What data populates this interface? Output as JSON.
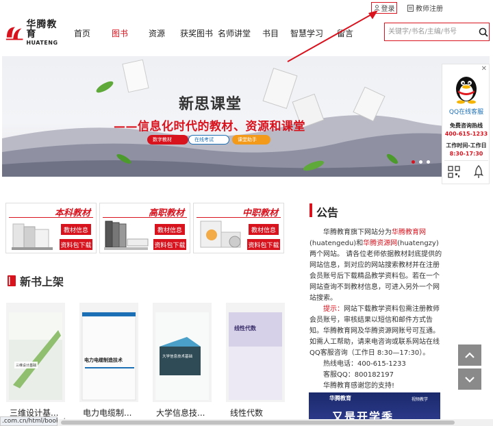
{
  "top_links": {
    "login": "登录",
    "teacher_register": "教师注册"
  },
  "logo": {
    "cn": "华腾教育",
    "en": "HUATENG"
  },
  "nav": [
    {
      "label": "首页"
    },
    {
      "label": "图书"
    },
    {
      "label": "资源"
    },
    {
      "label": "获奖图书"
    },
    {
      "label": "名师讲堂"
    },
    {
      "label": "书目"
    },
    {
      "label": "智慧学习"
    },
    {
      "label": "留言"
    }
  ],
  "search": {
    "placeholder": "关键字/书名/主编/书号"
  },
  "banner": {
    "title": "新思课堂",
    "subtitle": "——信息化时代的教材、资源和课堂",
    "pills": [
      "数字教材",
      "在线考试",
      "课堂助手"
    ]
  },
  "widget": {
    "qq": "QQ在线客服",
    "free_label": "免费咨询热线",
    "phone": "400-615-1233",
    "hours_label": "工作时间-工作日",
    "hours": "8:30-17:30"
  },
  "categories": [
    {
      "title": "本科教材",
      "info": "教材信息",
      "download": "资料包下载"
    },
    {
      "title": "高职教材",
      "info": "教材信息",
      "download": "资料包下载"
    },
    {
      "title": "中职教材",
      "info": "教材信息",
      "download": "资料包下载"
    }
  ],
  "new_books": {
    "title": "新书上架",
    "books": [
      {
        "title": "三维设计基...",
        "cover": "三维设计基础"
      },
      {
        "title": "电力电缆制...",
        "cover": "电力电缆制造技术"
      },
      {
        "title": "大学信息技...",
        "cover": "大学信息技术基础"
      },
      {
        "title": "线性代数",
        "cover": "线性代数"
      }
    ]
  },
  "announcement": {
    "title": "公告",
    "p1_a": "华腾教育旗下网站分为",
    "p1_link1": "华腾教育网",
    "p1_b": "(huatengedu)和",
    "p1_link2": "华腾资源网",
    "p1_c": "(huatengzy)两个网站。 请各位老师依据教材封底提供的网站信息，到对应的网站搜索教材并在注册会员账号后下载精品教学资料包。若在一个网站查询不到教材信息，可进入另外一个网站搜索。",
    "tip_label": "提示：",
    "tip_text": "网站下载教学资料包需注册教师会员账号，审核结果以短信和邮件方式告知。华腾教育网及华腾资源网账号可互通。如需人工帮助，请来电咨询或联系网站在线QQ客服咨询（工作日 8:30—17:30）。",
    "hotline": "热线电话：400-615-1233",
    "qq": "客服QQ：800182197",
    "thanks": "华腾教育感谢您的支持!",
    "img_label": "华腾教育",
    "img_caption": "视频教学",
    "img_text": "又是开学季"
  },
  "status_url": ".com.cn/html/books/",
  "colors": {
    "brand_red": "#d8131e",
    "link_blue": "#1b6fb5"
  }
}
